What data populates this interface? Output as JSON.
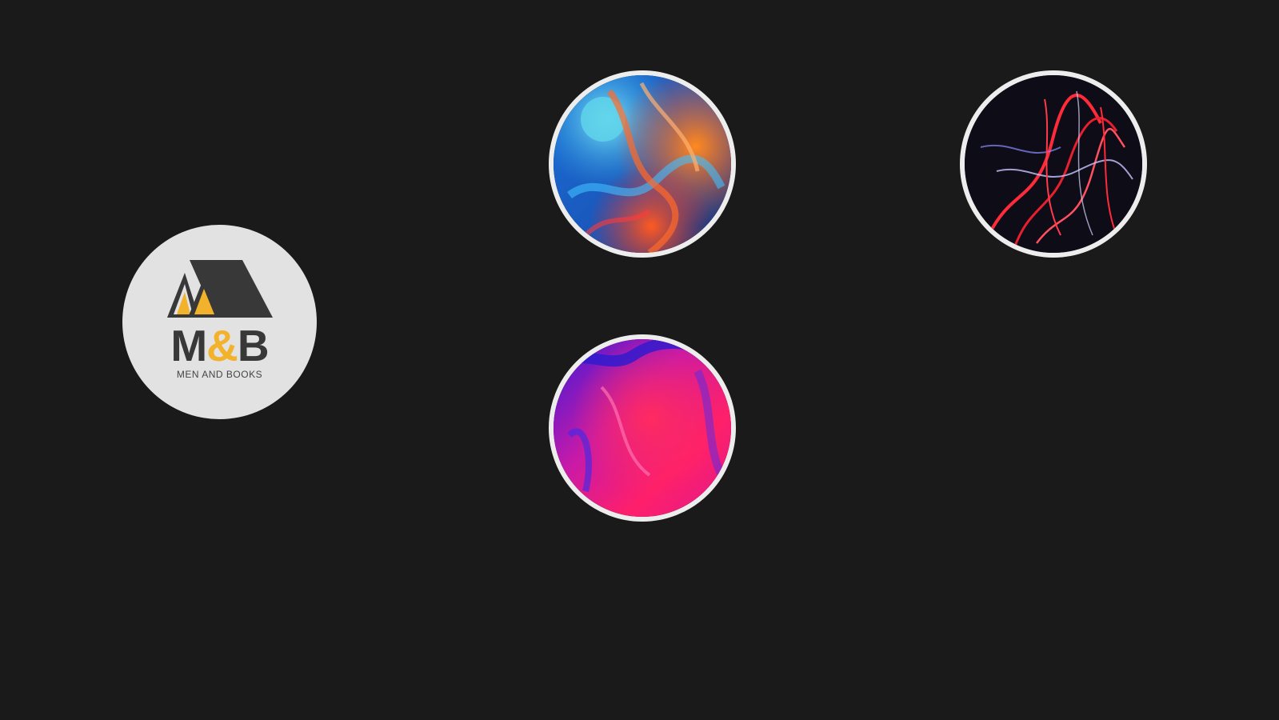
{
  "brand": {
    "wordmark_m": "M",
    "wordmark_amp": "&",
    "wordmark_b": "B",
    "tagline": "MEN AND BOOKS",
    "colors": {
      "circle": "#e2e2e2",
      "dark": "#383838",
      "accent": "#f2b22b"
    }
  },
  "stories": [
    {
      "icon": "abstract-ink-blue-orange-image"
    },
    {
      "icon": "abstract-light-trails-red-image"
    },
    {
      "icon": "abstract-paint-pink-purple-image"
    }
  ],
  "background_color": "#1a1a1a"
}
